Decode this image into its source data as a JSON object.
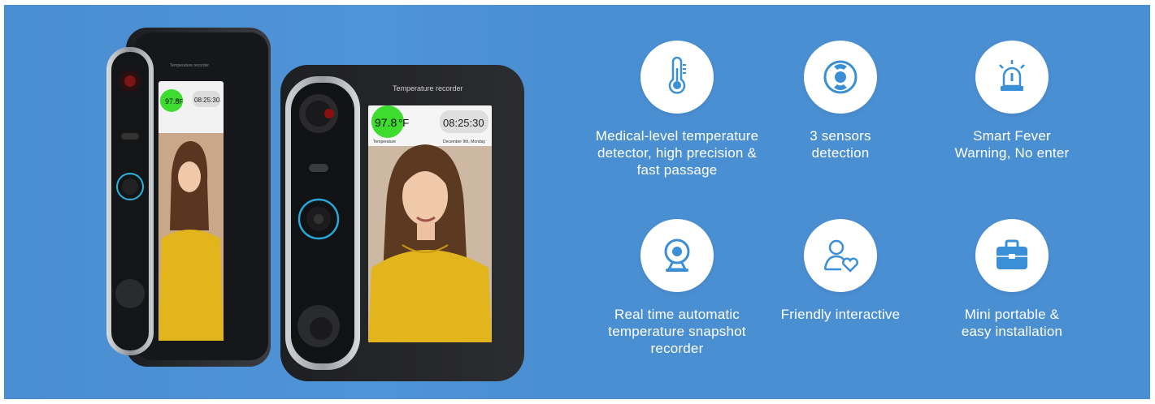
{
  "devices": {
    "header_label": "Temperature recorder",
    "temperature": "97.8",
    "unit": "°F",
    "temp_caption": "Temperature",
    "time": "08:25:30",
    "date_caption": "December 9th, Monday"
  },
  "features": [
    {
      "icon": "thermometer-icon",
      "label": "Medical-level temperature\ndetector, high precision &\nfast passage"
    },
    {
      "icon": "sensors-icon",
      "label": "3 sensors\ndetection"
    },
    {
      "icon": "alarm-light-icon",
      "label": "Smart Fever\nWarning, No enter"
    },
    {
      "icon": "webcam-icon",
      "label": "Real time automatic\ntemperature snapshot\nrecorder"
    },
    {
      "icon": "user-heart-icon",
      "label": "Friendly interactive"
    },
    {
      "icon": "briefcase-icon",
      "label": "Mini portable &\neasy installation"
    }
  ],
  "colors": {
    "background": "#4b8fd3",
    "icon_blue": "#3a8fd6",
    "temp_green": "#3ddc2e",
    "sweater": "#e2b51c"
  }
}
